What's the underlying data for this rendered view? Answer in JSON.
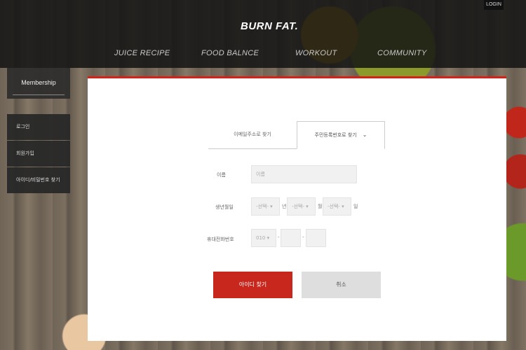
{
  "header": {
    "login_label": "LOGIN",
    "logo": "BURN FAT.",
    "nav": [
      "JUICE RECIPE",
      "FOOD BALNCE",
      "WORKOUT",
      "COMMUNITY"
    ]
  },
  "sidebar": {
    "title": "Membership",
    "items": [
      "로그인",
      "회원가입",
      "아이디/비밀번호 찾기"
    ]
  },
  "tabs": {
    "email": "이메일주소로 찾기",
    "resident": "주민등록번호로 찾기"
  },
  "form": {
    "name_label": "이름",
    "name_placeholder": "이름",
    "birth_label": "생년월일",
    "birth_year": "-선택-",
    "birth_year_suffix": "년",
    "birth_month": "-선택-",
    "birth_month_suffix": "월",
    "birth_day": "-선택-",
    "birth_day_suffix": "일",
    "phone_label": "휴대전화번호",
    "phone_prefix": "010",
    "phone_dash_1": "-",
    "phone_dash_2": "-"
  },
  "buttons": {
    "find": "아이디 찾기",
    "cancel": "취소"
  },
  "colors": {
    "accent": "#c8271e",
    "header_bg": "#141414"
  }
}
